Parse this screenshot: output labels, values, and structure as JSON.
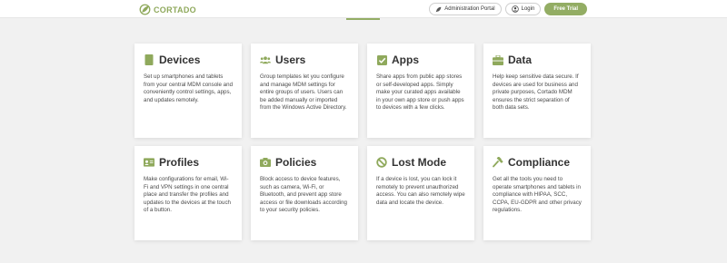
{
  "header": {
    "brand": "CORTADO",
    "admin_portal": "Administration Portal",
    "login": "Login",
    "free_trial": "Free Trial"
  },
  "colors": {
    "accent": "#93ad64",
    "background": "#f1f1f1"
  },
  "features": [
    {
      "title": "Devices",
      "icon": "smartphone-icon",
      "description": "Set up smartphones and tablets from your central MDM console and conveniently control settings, apps, and updates remotely."
    },
    {
      "title": "Users",
      "icon": "users-icon",
      "description": "Group templates let you configure and manage MDM settings for entire groups of users. Users can be added manually or imported from the Windows Active Directory."
    },
    {
      "title": "Apps",
      "icon": "check-square-icon",
      "description": "Share apps from public app stores or self-developed apps. Simply make your curated apps available in your own  app store or push apps to devices with a few clicks."
    },
    {
      "title": "Data",
      "icon": "briefcase-icon",
      "description": "Help keep sensitive data secure. If devices are used for business and private purposes, Cortado MDM ensures the strict separation of both data sets."
    },
    {
      "title": "Profiles",
      "icon": "id-card-icon",
      "description": "Make configurations for email, Wi-Fi and VPN settings in one central place and transfer the profiles and updates to the devices at the touch of a button."
    },
    {
      "title": "Policies",
      "icon": "camera-icon",
      "description": "Block access to device features, such as camera, Wi-Fi, or Bluetooth, and prevent app store access or file downloads according to your security policies."
    },
    {
      "title": "Lost Mode",
      "icon": "ban-icon",
      "description": "If a device is lost, you can lock it remotely to prevent unauthorized access. You can also remotely wipe data and locate the device."
    },
    {
      "title": "Compliance",
      "icon": "gavel-icon",
      "description": "Get all the tools you need to operate smartphones and tablets in compliance with HIPAA, SCC, CCPA, EU-GDPR and other privacy regulations."
    }
  ]
}
